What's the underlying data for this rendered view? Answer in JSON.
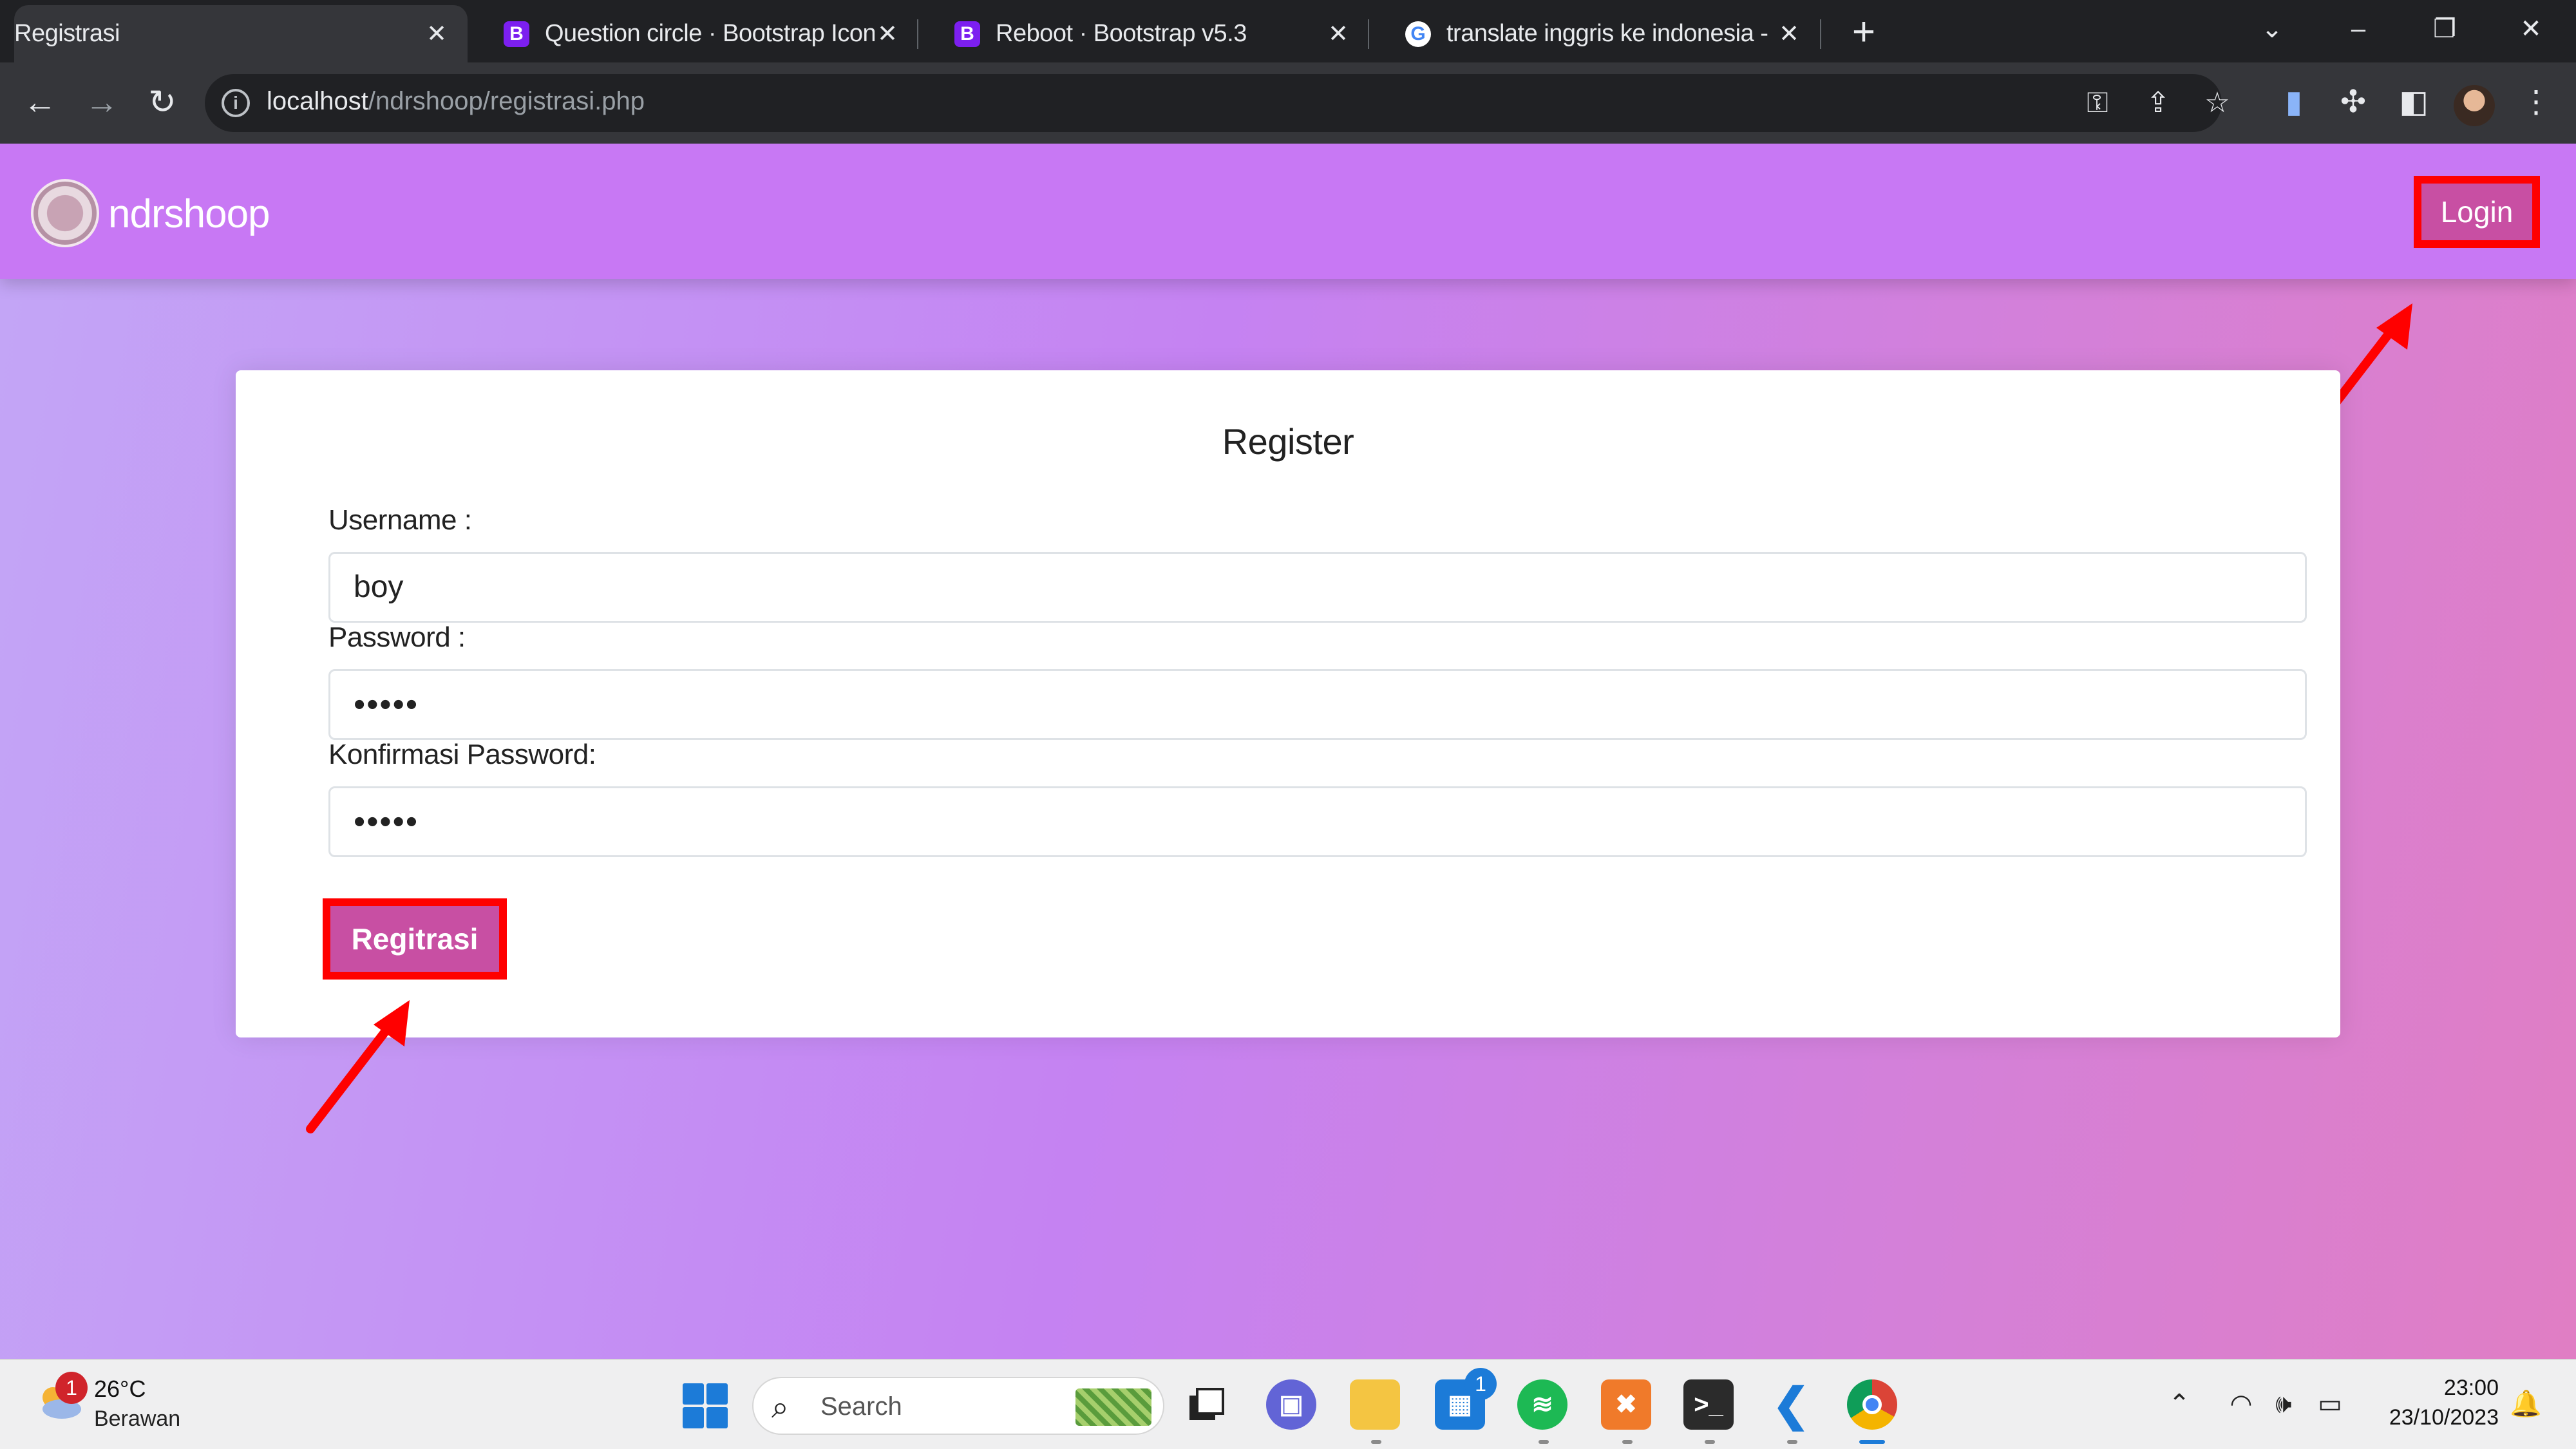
{
  "browser": {
    "tabs": [
      {
        "title": "Registrasi",
        "favicon": "site-logo-icon",
        "active": true
      },
      {
        "title": "Question circle · Bootstrap Icons",
        "favicon": "bootstrap-icon",
        "active": false
      },
      {
        "title": "Reboot · Bootstrap v5.3",
        "favicon": "bootstrap-icon",
        "active": false
      },
      {
        "title": "translate inggris ke indonesia - P",
        "favicon": "google-icon",
        "active": false
      }
    ],
    "address": {
      "host": "localhost",
      "path": "/ndrshoop/registrasi.php"
    },
    "bootstrap_glyph": "B",
    "google_glyph": "G"
  },
  "site": {
    "brand": "ndrshoop",
    "nav": {
      "login_label": "Login"
    }
  },
  "form": {
    "title": "Register",
    "username": {
      "label": "Username :",
      "value": "boy"
    },
    "password": {
      "label": "Password :",
      "value": "•••••"
    },
    "confirm": {
      "label": "Konfirmasi Password:",
      "value": "•••••"
    },
    "submit_label": "Regitrasi"
  },
  "taskbar": {
    "weather": {
      "temp": "26°C",
      "desc": "Berawan",
      "badge": "1"
    },
    "search_label": "Search",
    "store_badge": "1",
    "clock": {
      "time": "23:00",
      "date": "23/10/2023"
    }
  },
  "colors": {
    "navbar": "#c878f4",
    "button": "#c84fa3",
    "highlight": "#ff0000"
  }
}
